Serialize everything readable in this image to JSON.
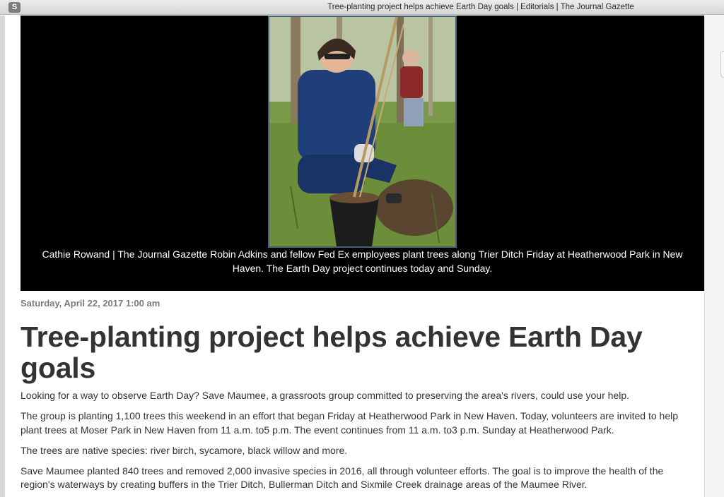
{
  "window": {
    "app_icon_letter": "S",
    "title": "Tree-planting project helps achieve Earth Day goals | Editorials | The Journal Gazette"
  },
  "article": {
    "photo_caption": "Cathie Rowand | The Journal Gazette Robin Adkins and fellow Fed Ex employees plant trees along Trier Ditch Friday at Heatherwood Park in New Haven. The Earth Day project continues today and Sunday.",
    "dateline": "Saturday, April 22, 2017 1:00 am",
    "headline": "Tree-planting project helps achieve Earth Day goals",
    "paragraphs": [
      "Looking for a way to observe Earth Day? Save Maumee, a grassroots group committed to preserving the area's rivers, could use your help.",
      "The group is planting 1,100 trees this weekend in an effort that began Friday at Heatherwood Park in New Haven. Today, volunteers are invited to help plant trees at Moser Park in New Haven from 11 a.m. to5 p.m. The event continues from 11 a.m. to3 p.m. Sunday at Heatherwood Park.",
      "The trees are native species: river birch, sycamore, black willow and more.",
      "Save Maumee planted 840 trees and removed 2,000 invasive species in 2016, all through volunteer efforts. The goal is to improve the health of the region's waterways by creating buffers in the Trier Ditch, Bullerman Ditch and Sixmile Creek drainage areas of the Maumee River."
    ]
  }
}
